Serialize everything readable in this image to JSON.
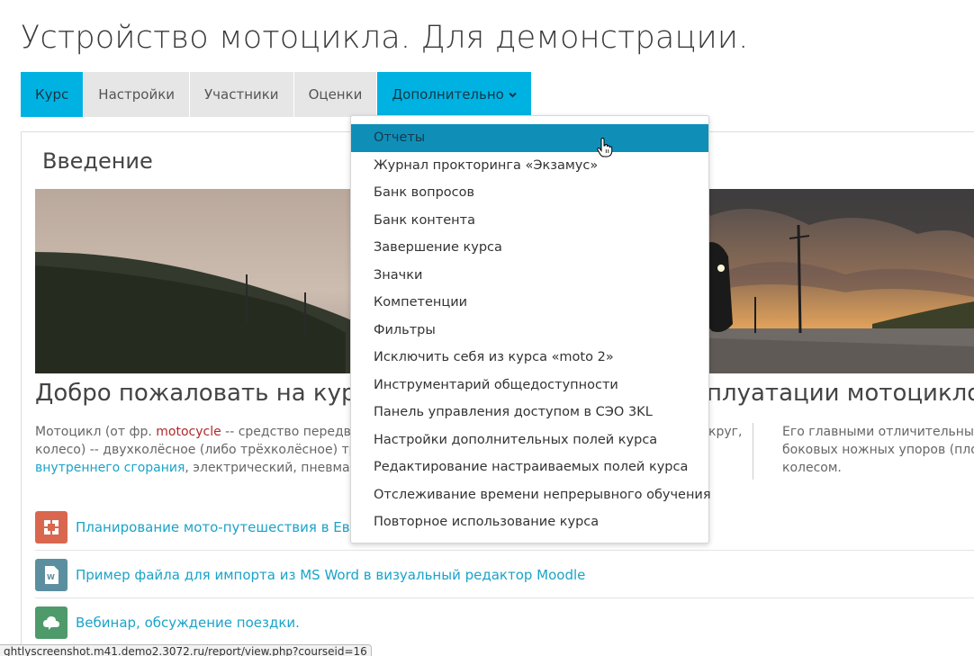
{
  "page": {
    "title": "Устройство мотоцикла. Для демонстрации."
  },
  "tabs": [
    {
      "label": "Курс"
    },
    {
      "label": "Настройки"
    },
    {
      "label": "Участники"
    },
    {
      "label": "Оценки"
    },
    {
      "label": "Дополнительно",
      "caret": "⌄"
    }
  ],
  "section": {
    "title": "Введение"
  },
  "welcome": {
    "left": "Добро пожаловать на курс,",
    "right": "плуатации мотоциклов!"
  },
  "description": {
    "line1_a": "Мотоцикл (от фр. ",
    "line1_red": "motocycle",
    "line1_b": " -- средство передвижени",
    "line2": "колесо) -- двухколёсное (либо трёхколёсное) транспо",
    "line3_link": "внутреннего сгорания",
    "line3_b": ", электрический, пневматическ",
    "right_line1_end": "круг,",
    "col2_line1": "Его главными отличительными ч",
    "col2_line2": "боковых ножных упоров (площа",
    "col2_line3": "колесом."
  },
  "activities": [
    {
      "label": "Планирование мото-путешествия в Европу",
      "icon": "scorm-package-icon",
      "color": "#d9674f"
    },
    {
      "label": "Пример файла для импорта из MS Word в визуальный редактор Moodle",
      "icon": "word-document-icon",
      "color": "#5b8fa0"
    },
    {
      "label": "Вебинар, обсуждение поездки.",
      "icon": "webinar-icon",
      "color": "#4f9a6a"
    }
  ],
  "dropdown": {
    "items": [
      {
        "label": "Отчеты"
      },
      {
        "label": "Журнал прокторинга «Экзамус»"
      },
      {
        "label": "Банк вопросов"
      },
      {
        "label": "Банк контента"
      },
      {
        "label": "Завершение курса"
      },
      {
        "label": "Значки"
      },
      {
        "label": "Компетенции"
      },
      {
        "label": "Фильтры"
      },
      {
        "label": "Исключить себя из курса «moto 2»"
      },
      {
        "label": "Инструментарий общедоступности"
      },
      {
        "label": "Панель управления доступом в СЭО 3KL"
      },
      {
        "label": "Настройки дополнительных полей курса"
      },
      {
        "label": "Редактирование настраиваемых полей курса"
      },
      {
        "label": "Отслеживание времени непрерывного обучения"
      },
      {
        "label": "Повторное использование курса"
      }
    ]
  },
  "statusbar": {
    "url": "ghtlyscreenshot.m41.demo2.3072.ru/report/view.php?courseid=16"
  },
  "colors": {
    "accent": "#00b2e2",
    "menu_hover": "#0f8fb8",
    "link": "#1aa3c9"
  }
}
